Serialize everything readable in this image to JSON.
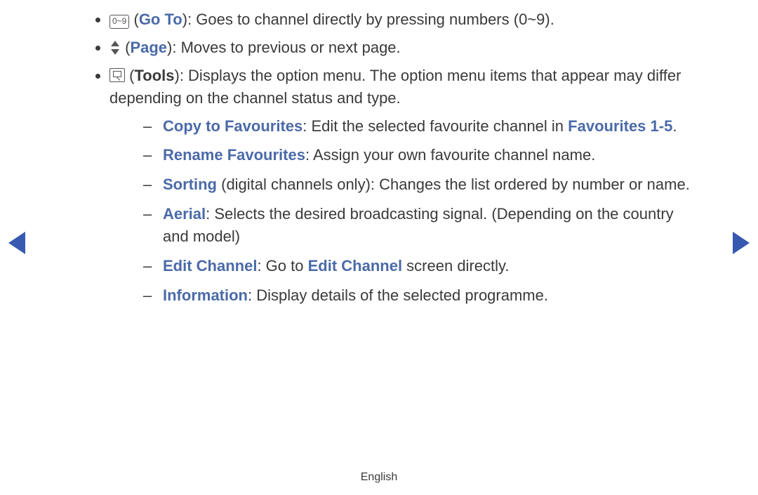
{
  "items": [
    {
      "icon": "num-keys-icon",
      "icon_text": "0~9",
      "label": "Go To",
      "desc": ": Goes to channel directly by pressing numbers (0~9)."
    },
    {
      "icon": "updown-icon",
      "label": "Page",
      "desc": ": Moves to previous or next page."
    },
    {
      "icon": "tools-icon",
      "label": "Tools",
      "desc": ": Displays the option menu. The option menu items that appear may differ depending on the channel status and type."
    }
  ],
  "sub": [
    {
      "label": "Copy to Favourites",
      "desc_a": ": Edit the selected favourite channel in ",
      "link": "Favourites 1-5",
      "desc_b": "."
    },
    {
      "label": "Rename Favourites",
      "desc_a": ": Assign your own favourite channel name."
    },
    {
      "label": "Sorting",
      "paren": " (digital channels only)",
      "desc_a": ": Changes the list ordered by number or name."
    },
    {
      "label": "Aerial",
      "desc_a": ": Selects the desired broadcasting signal. (Depending on the country and model)"
    },
    {
      "label": "Edit Channel",
      "desc_a": ": Go to ",
      "link": "Edit Channel",
      "desc_b": " screen directly."
    },
    {
      "label": "Information",
      "desc_a": ": Display details of the selected programme."
    }
  ],
  "footer": "English"
}
